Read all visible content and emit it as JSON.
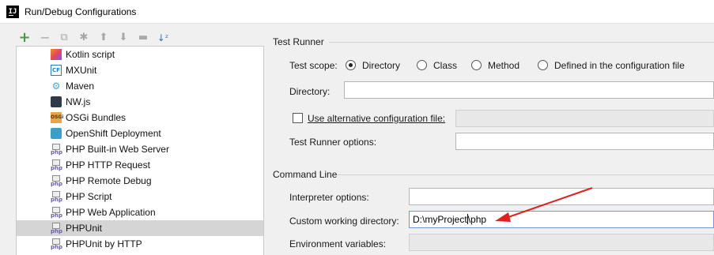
{
  "window": {
    "title": "Run/Debug Configurations"
  },
  "toolbar": {
    "add_icon": "plus-icon",
    "remove_icon": "minus-icon",
    "copy_icon": "copy-icon",
    "edit_defaults_icon": "wrench-icon",
    "move_up_icon": "arrow-up-icon",
    "move_down_icon": "arrow-down-icon",
    "folder_icon": "folder-icon",
    "sort_icon": "sort-az-icon"
  },
  "tree": {
    "items": [
      {
        "label": "Kotlin script",
        "icon": "kotlin-icon"
      },
      {
        "label": "MXUnit",
        "icon": "coldfusion-icon"
      },
      {
        "label": "Maven",
        "icon": "maven-icon"
      },
      {
        "label": "NW.js",
        "icon": "nwjs-icon"
      },
      {
        "label": "OSGi Bundles",
        "icon": "osgi-icon"
      },
      {
        "label": "OpenShift Deployment",
        "icon": "openshift-icon"
      },
      {
        "label": "PHP Built-in Web Server",
        "icon": "php-icon"
      },
      {
        "label": "PHP HTTP Request",
        "icon": "php-icon"
      },
      {
        "label": "PHP Remote Debug",
        "icon": "php-icon"
      },
      {
        "label": "PHP Script",
        "icon": "php-icon"
      },
      {
        "label": "PHP Web Application",
        "icon": "php-icon"
      },
      {
        "label": "PHPUnit",
        "icon": "php-icon",
        "selected": true
      },
      {
        "label": "PHPUnit by HTTP",
        "icon": "php-icon"
      }
    ]
  },
  "test_runner": {
    "section_title": "Test Runner",
    "scope_label": "Test scope:",
    "scope_options": [
      "Directory",
      "Class",
      "Method",
      "Defined in the configuration file"
    ],
    "scope_selected": "Directory",
    "directory_label": "Directory:",
    "directory_value": "",
    "alt_config_label": "Use alternative configuration file:",
    "alt_config_checked": false,
    "alt_config_value": "",
    "runner_options_label": "Test Runner options:",
    "runner_options_value": ""
  },
  "command_line": {
    "section_title": "Command Line",
    "interpreter_options_label": "Interpreter options:",
    "interpreter_options_value": "",
    "working_dir_label": "Custom working directory:",
    "working_dir_value_before_caret": "D:\\myProject",
    "working_dir_value_after_caret": "\\php",
    "env_vars_label": "Environment variables:",
    "env_vars_value": ""
  },
  "annotation": {
    "arrow_color": "#e02020"
  }
}
